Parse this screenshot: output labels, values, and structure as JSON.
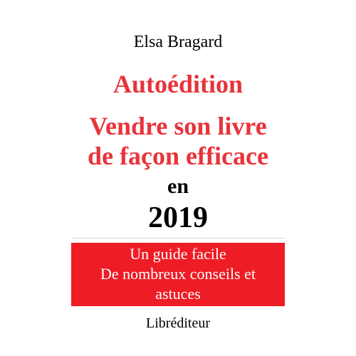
{
  "colors": {
    "background": "#ffffff",
    "title_red": "#e8333a",
    "banner_red": "#ee1c24",
    "text": "#000000",
    "banner_text": "#ffffff"
  },
  "cover": {
    "author": "Elsa Bragard",
    "title_lines": [
      "Autoédition",
      "Vendre son livre",
      "de façon efficace"
    ],
    "connector": "en",
    "year": "2019",
    "banner_lines": [
      "Un guide facile",
      "De nombreux conseils et",
      "astuces"
    ],
    "publisher": "Libréditeur"
  }
}
